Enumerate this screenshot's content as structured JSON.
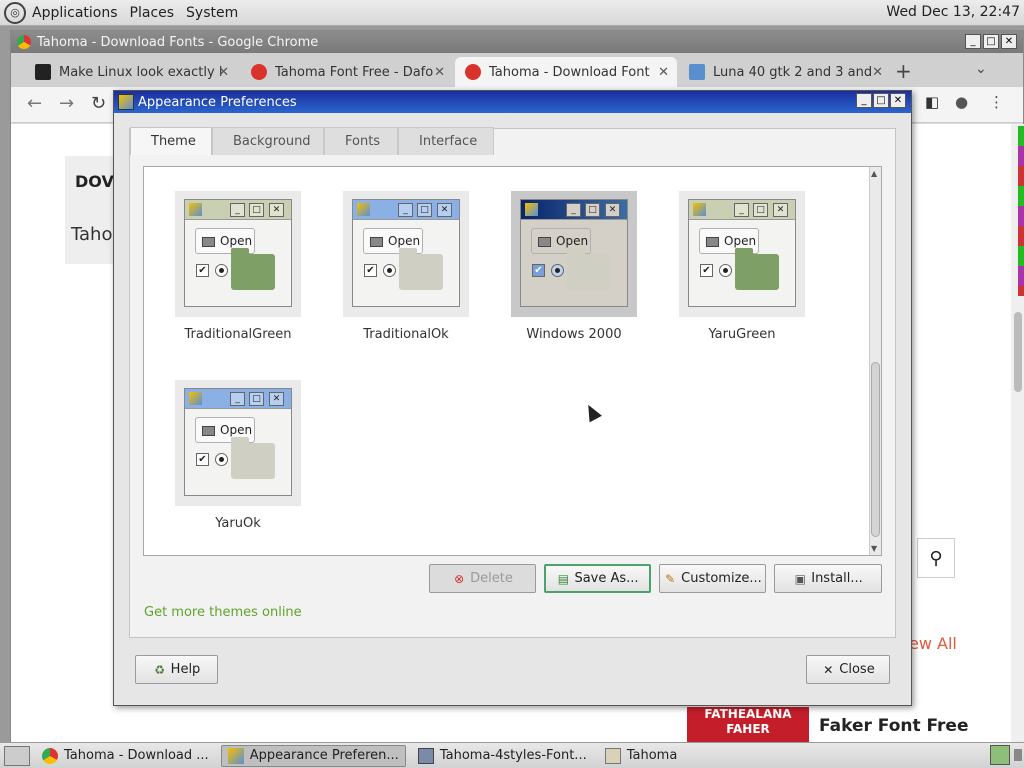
{
  "top_panel": {
    "menus": [
      "Applications",
      "Places",
      "System"
    ],
    "clock": "Wed Dec 13, 22:47"
  },
  "chrome": {
    "title": "Tahoma - Download Fonts - Google Chrome",
    "tabs": [
      {
        "label": "Make Linux look exactly l",
        "icon": "windows-logo-icon"
      },
      {
        "label": "Tahoma Font Free - Dafo",
        "icon": "dafont-icon"
      },
      {
        "label": "Tahoma - Download Font",
        "icon": "dafont-icon",
        "active": true
      },
      {
        "label": "Luna 40 gtk 2 and 3 and",
        "icon": "gnome-look-icon"
      }
    ],
    "page": {
      "download_heading": "DOV",
      "tahoma_text": "Taho",
      "view_all": "ew All",
      "faker_image_text": "FATHEALANA FAHER",
      "faker_font": "Faker Font Free"
    }
  },
  "dialog": {
    "title": "Appearance Preferences",
    "tabs": [
      "Theme",
      "Background",
      "Fonts",
      "Interface"
    ],
    "themes": [
      {
        "name": "TraditionalGreen",
        "open_label": "Open",
        "titlebar_color": "#c9cfb2",
        "folder_color": "#7ea066"
      },
      {
        "name": "TraditionalOk",
        "open_label": "Open",
        "titlebar_color": "#8ab0e6",
        "folder_color": "#cfcfc4"
      },
      {
        "name": "Windows 2000",
        "open_label": "Open",
        "titlebar_color": "#1c2f9e",
        "folder_color": "#cfcfc4",
        "selected": true
      },
      {
        "name": "YaruGreen",
        "open_label": "Open",
        "titlebar_color": "#c9cfb2",
        "folder_color": "#7ea066"
      },
      {
        "name": "YaruOk",
        "open_label": "Open",
        "titlebar_color": "#8ab0e6",
        "folder_color": "#cfcfc4"
      }
    ],
    "buttons": {
      "delete": "Delete",
      "save_as": "Save As...",
      "customize": "Customize...",
      "install": "Install...",
      "help": "Help",
      "close": "Close"
    },
    "get_more": "Get more themes online"
  },
  "taskbar": {
    "items": [
      {
        "label": "Tahoma - Download ...",
        "icon": "chrome-icon"
      },
      {
        "label": "Appearance Preferen...",
        "icon": "appearance-icon",
        "active": true
      },
      {
        "label": "Tahoma-4styles-Font...",
        "icon": "archive-icon"
      },
      {
        "label": "Tahoma",
        "icon": "folder-icon"
      }
    ]
  }
}
